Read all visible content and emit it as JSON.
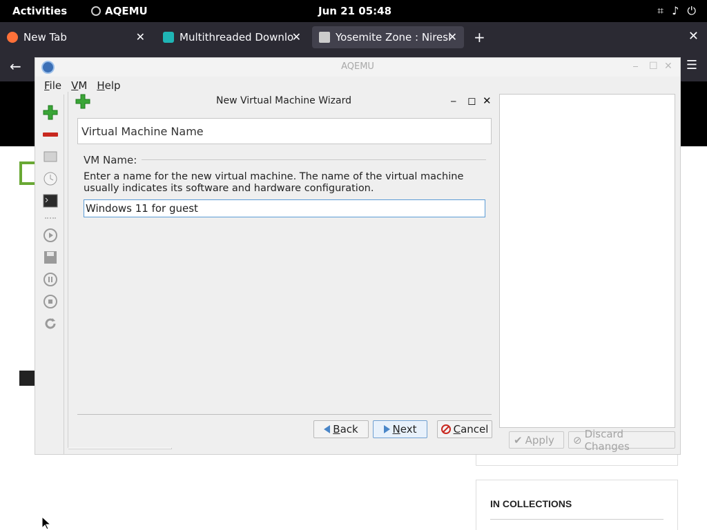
{
  "topbar": {
    "activities": "Activities",
    "app_name": "AQEMU",
    "clock": "Jun 21  05:48",
    "tray_icons": [
      "network-icon",
      "volume-icon",
      "power-icon"
    ]
  },
  "browser": {
    "tabs": [
      {
        "title": "New Tab",
        "icon": "firefox-icon",
        "active": false
      },
      {
        "title": "Multithreaded Downlo",
        "icon": "puzzle-icon",
        "active": false
      },
      {
        "title": "Yosemite Zone : Niresh",
        "icon": "museum-icon",
        "active": true
      }
    ],
    "new_tab_glyph": "+",
    "close_glyph": "✕"
  },
  "webpage": {
    "collections_heading": "IN COLLECTIONS"
  },
  "aqemu": {
    "window_title": "AQEMU",
    "menu": [
      {
        "label": "File"
      },
      {
        "label": "VM"
      },
      {
        "label": "Help"
      }
    ],
    "apply_label": "Apply",
    "discard_label": "Discard Changes"
  },
  "wizard": {
    "title": "New Virtual Machine Wizard",
    "page_header": "Virtual Machine Name",
    "group_label": "VM Name:",
    "description": "Enter a name for the new virtual machine. The name of the virtual machine usually indicates its software and hardware configuration.",
    "vm_name_value": "Windows 11 for guest",
    "back_label": "Back",
    "next_label": "Next",
    "cancel_label": "Cancel"
  },
  "colors": {
    "accent_green": "#3aa537",
    "delete_red": "#c8281f",
    "focus_blue": "#5b9bd5"
  }
}
